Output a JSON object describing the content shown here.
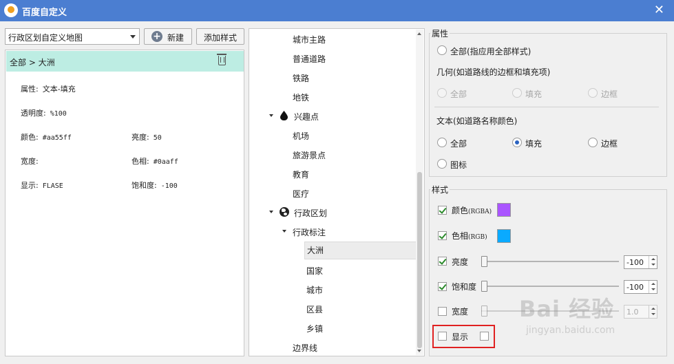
{
  "window": {
    "title": "百度自定义",
    "close_glyph": "✕"
  },
  "toolbar": {
    "map_select_value": "行政区划自定义地图",
    "new_label": "新建",
    "add_style_label": "添加样式"
  },
  "selection": {
    "breadcrumb": "全部 > 大洲"
  },
  "properties": {
    "attr": {
      "label": "属性:",
      "value": "文本-填充"
    },
    "opacity": {
      "label": "透明度:",
      "value": "%100"
    },
    "color": {
      "label": "颜色:",
      "value": "#aa55ff"
    },
    "brightness": {
      "label": "亮度:",
      "value": "50"
    },
    "width": {
      "label": "宽度:",
      "value": ""
    },
    "hue": {
      "label": "色相:",
      "value": "#0aaff"
    },
    "display": {
      "label": "显示:",
      "value": "FLASE"
    },
    "saturation": {
      "label": "饱和度:",
      "value": "-100"
    }
  },
  "tree": {
    "items": [
      {
        "label": "城市主路"
      },
      {
        "label": "普通道路"
      },
      {
        "label": "铁路"
      },
      {
        "label": "地铁"
      },
      {
        "label": "兴趣点"
      },
      {
        "label": "机场"
      },
      {
        "label": "旅游景点"
      },
      {
        "label": "教育"
      },
      {
        "label": "医疗"
      },
      {
        "label": "行政区划"
      },
      {
        "label": "行政标注"
      },
      {
        "label": "大洲"
      },
      {
        "label": "国家"
      },
      {
        "label": "城市"
      },
      {
        "label": "区县"
      },
      {
        "label": "乡镇"
      },
      {
        "label": "边界线"
      }
    ]
  },
  "attributes_group": {
    "title": "属性",
    "all_label": "全部(指应用全部样式)",
    "geometry_label": "几何(如道路线的边框和填充项)",
    "geometry_options": [
      "全部",
      "填充",
      "边框"
    ],
    "text_label": "文本(如道路名称颜色)",
    "text_options": [
      "全部",
      "填充",
      "边框"
    ],
    "icon_label": "图标"
  },
  "style_group": {
    "title": "样式",
    "color": {
      "label": "颜色",
      "suffix": "(RGBA)",
      "swatch": "#aa55ff",
      "checked": true
    },
    "hue": {
      "label": "色相",
      "suffix": "(RGB)",
      "swatch": "#0aaaff",
      "checked": true
    },
    "brightness": {
      "label": "亮度",
      "value": "-100",
      "checked": true
    },
    "saturation": {
      "label": "饱和度",
      "value": "-100",
      "checked": true
    },
    "width": {
      "label": "宽度",
      "value": "1.0",
      "checked": false
    },
    "display": {
      "label": "显示",
      "checked": false
    }
  },
  "watermark": {
    "main": "Bai 经验",
    "sub": "jingyan.baidu.com"
  },
  "colors": {
    "title_bar": "#4b7ed1",
    "selected_row": "#bdede3",
    "highlight": "#e02020"
  }
}
